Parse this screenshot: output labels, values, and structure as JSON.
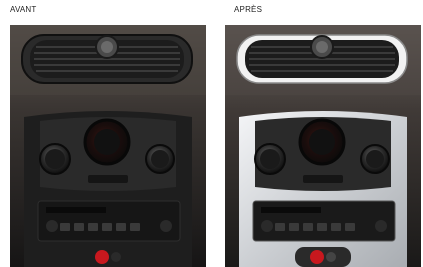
{
  "labels": {
    "before": "AVANT",
    "after": "APRÈS"
  },
  "photos": [
    {
      "id": "before",
      "description_colors": {
        "vent_bezel": "#2a2a2a",
        "console_panel": "#1e1e1e"
      }
    },
    {
      "id": "after",
      "description_colors": {
        "vent_bezel": "#f2f2f2",
        "console_panel": "#cfd2d5"
      }
    }
  ],
  "colors": {
    "background": "#ffffff",
    "label_text": "#222222",
    "dashboard_dark": "#141414",
    "dashboard_mid": "#3a3a3a",
    "accent_red": "#c8181e"
  }
}
